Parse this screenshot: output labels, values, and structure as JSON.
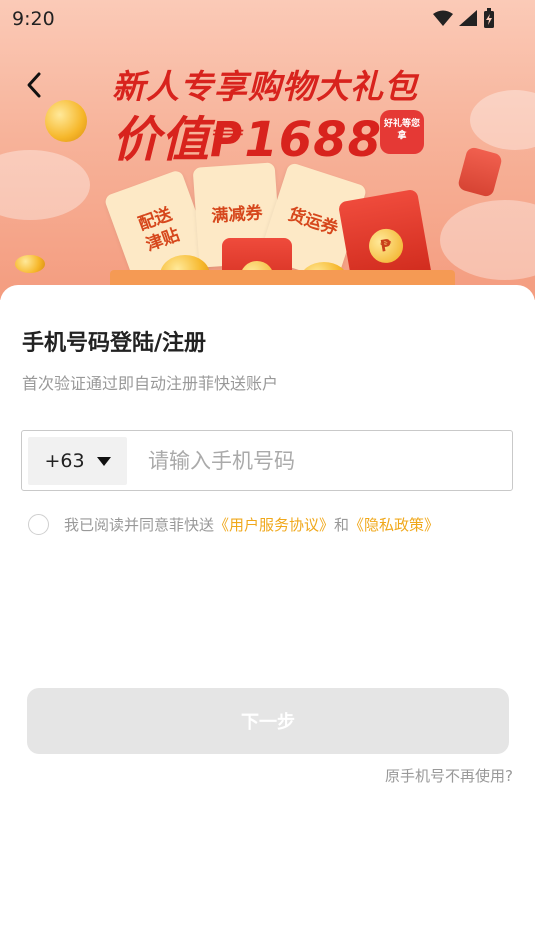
{
  "status_bar": {
    "time": "9:20",
    "icons": [
      "wifi-icon",
      "signal-icon",
      "battery-charging-icon"
    ]
  },
  "banner": {
    "headline": "新人专享购物大礼包",
    "value_line": "价值₱1688",
    "gift_badge": "好礼等您拿",
    "tickets": [
      "配送津贴",
      "满减券",
      "货运券"
    ],
    "coin_symbol": "₱"
  },
  "form": {
    "title": "手机号码登陆/注册",
    "subtitle": "首次验证通过即自动注册菲快送账户",
    "country_code": "+63",
    "phone_placeholder": "请输入手机号码",
    "agreement": {
      "prefix": "我已阅读并同意菲快送",
      "user_agreement": "《用户服务协议》",
      "conjunction": "和",
      "privacy_policy": "《隐私政策》"
    },
    "next_button": "下一步",
    "old_phone_link": "原手机号不再使用?"
  },
  "colors": {
    "accent_link": "#f0a81c",
    "headline_red": "#d8231d",
    "button_disabled": "#e5e5e5"
  }
}
